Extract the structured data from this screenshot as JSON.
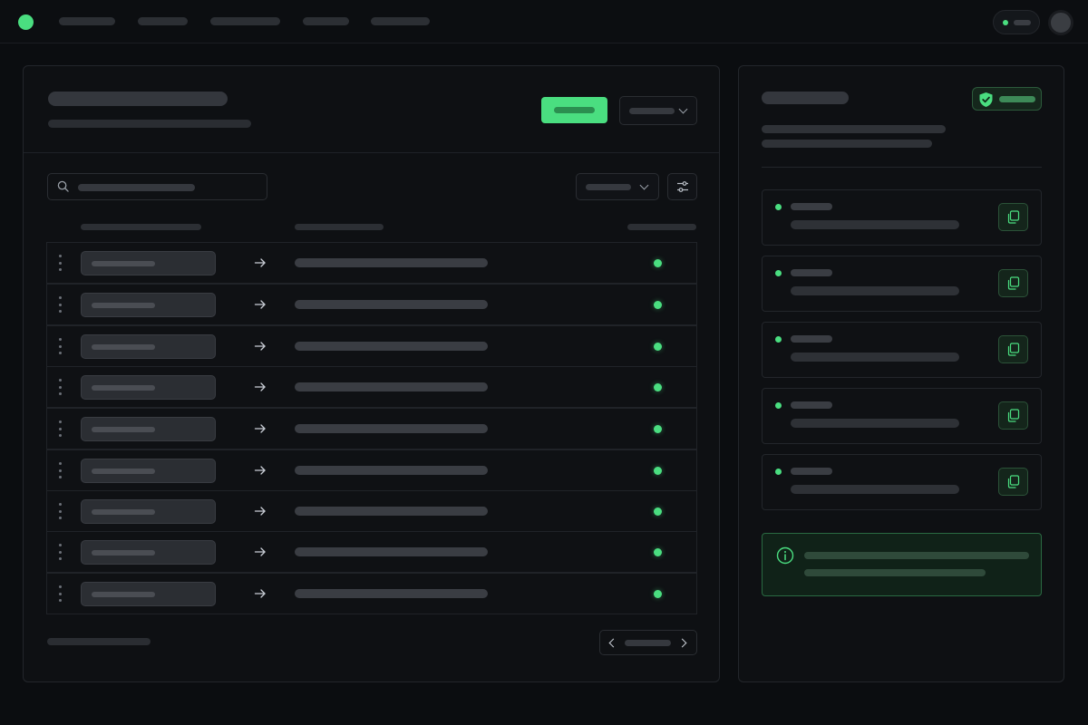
{
  "app": {
    "accent_color": "#4ade80",
    "logo_icon": "app-logo-dot"
  },
  "topnav": {
    "items": [
      "",
      "",
      "",
      "",
      ""
    ],
    "status_pill": {
      "label": "",
      "status_color": "#4ade80"
    },
    "avatar": "user-avatar"
  },
  "main": {
    "title": "",
    "subtitle": "",
    "primary_action": {
      "label": ""
    },
    "header_dropdown": {
      "selected": ""
    },
    "search": {
      "placeholder": "",
      "value": ""
    },
    "filter_dropdown": {
      "selected": ""
    },
    "columns": [
      "",
      "",
      ""
    ],
    "rows": [
      {
        "source": "",
        "target": "",
        "status": "active"
      },
      {
        "source": "",
        "target": "",
        "status": "active"
      },
      {
        "source": "",
        "target": "",
        "status": "active"
      },
      {
        "source": "",
        "target": "",
        "status": "active"
      },
      {
        "source": "",
        "target": "",
        "status": "active"
      },
      {
        "source": "",
        "target": "",
        "status": "active"
      },
      {
        "source": "",
        "target": "",
        "status": "active"
      },
      {
        "source": "",
        "target": "",
        "status": "active"
      },
      {
        "source": "",
        "target": "",
        "status": "active"
      }
    ],
    "footer_summary": "",
    "pagination": {
      "label": ""
    }
  },
  "side": {
    "title": "",
    "verified_badge": {
      "label": "",
      "icon": "shield-check-icon"
    },
    "description_lines": [
      "",
      ""
    ],
    "items": [
      {
        "name": "",
        "value": "",
        "status": "active"
      },
      {
        "name": "",
        "value": "",
        "status": "active"
      },
      {
        "name": "",
        "value": "",
        "status": "active"
      },
      {
        "name": "",
        "value": "",
        "status": "active"
      },
      {
        "name": "",
        "value": "",
        "status": "active"
      }
    ],
    "info_note": {
      "lines": [
        "",
        ""
      ],
      "icon": "info-icon"
    }
  }
}
